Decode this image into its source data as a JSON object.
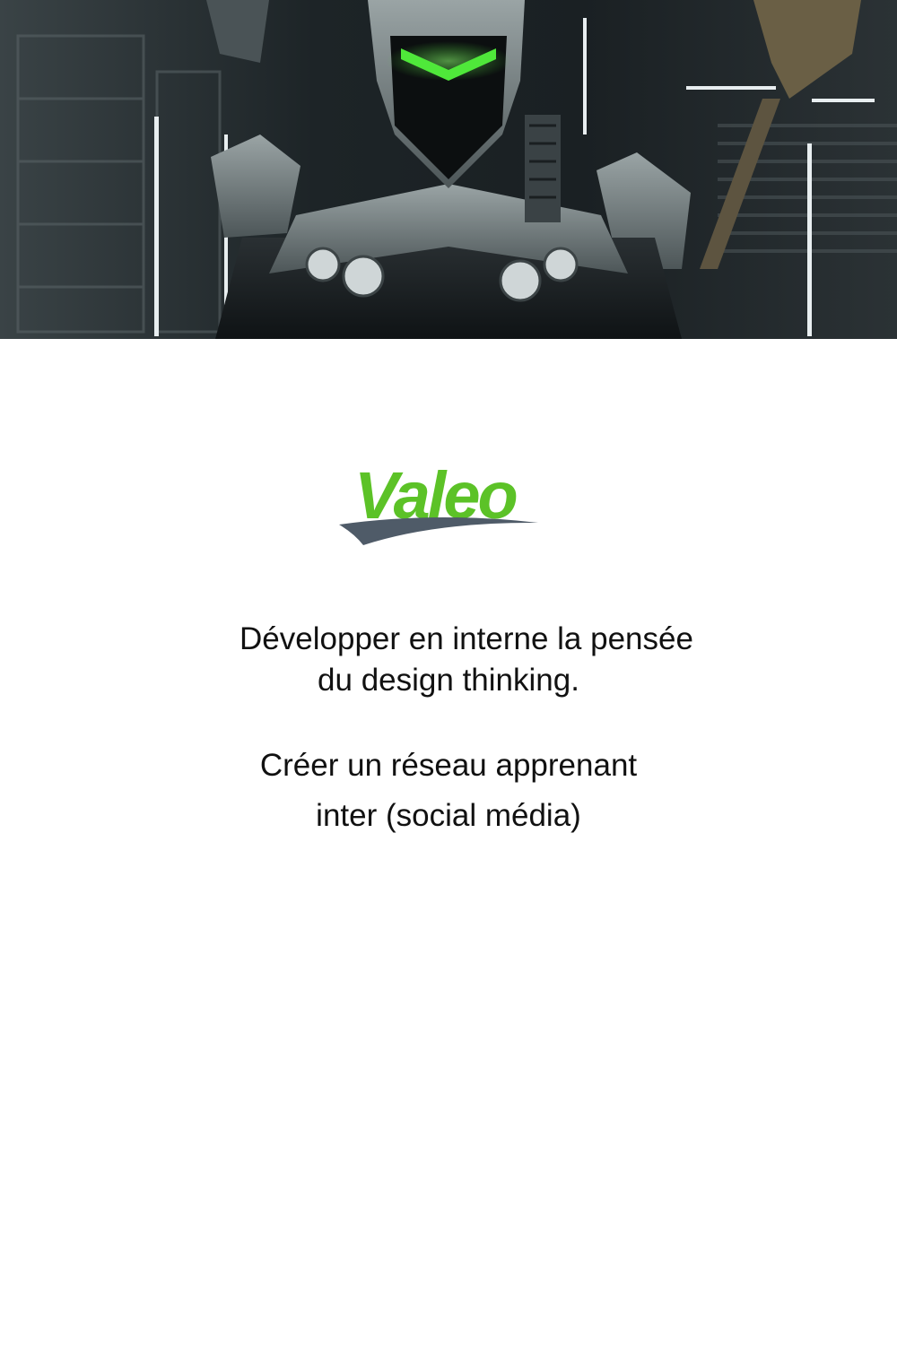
{
  "hero": {
    "image": "robot-hero-image",
    "accent_color": "#4fe83a"
  },
  "logo": {
    "text": "Valeo",
    "color": "#5cc227",
    "swoosh_color": "#4f5b68"
  },
  "captions": {
    "line1": "Développer en interne la pensée",
    "line2": "du design thinking.",
    "line3": "Créer un réseau apprenant",
    "line4": "inter (social média)"
  }
}
